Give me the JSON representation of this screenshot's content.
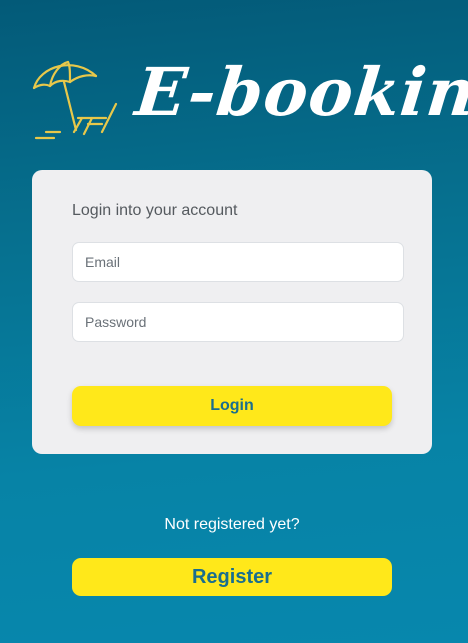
{
  "brand": {
    "name": "E-booking",
    "icon": "beach-umbrella-chair-icon",
    "icon_color": "#e8c84a"
  },
  "login_card": {
    "title": "Login into your account",
    "email_placeholder": "Email",
    "email_value": "",
    "password_placeholder": "Password",
    "password_value": "",
    "login_label": "Login"
  },
  "register": {
    "prompt": "Not registered yet?",
    "register_label": "Register"
  },
  "colors": {
    "background_top": "#035a78",
    "background_bottom": "#0787ad",
    "card_background": "#efeff1",
    "button_yellow": "#ffe81a",
    "button_text": "#1a6e8e"
  }
}
